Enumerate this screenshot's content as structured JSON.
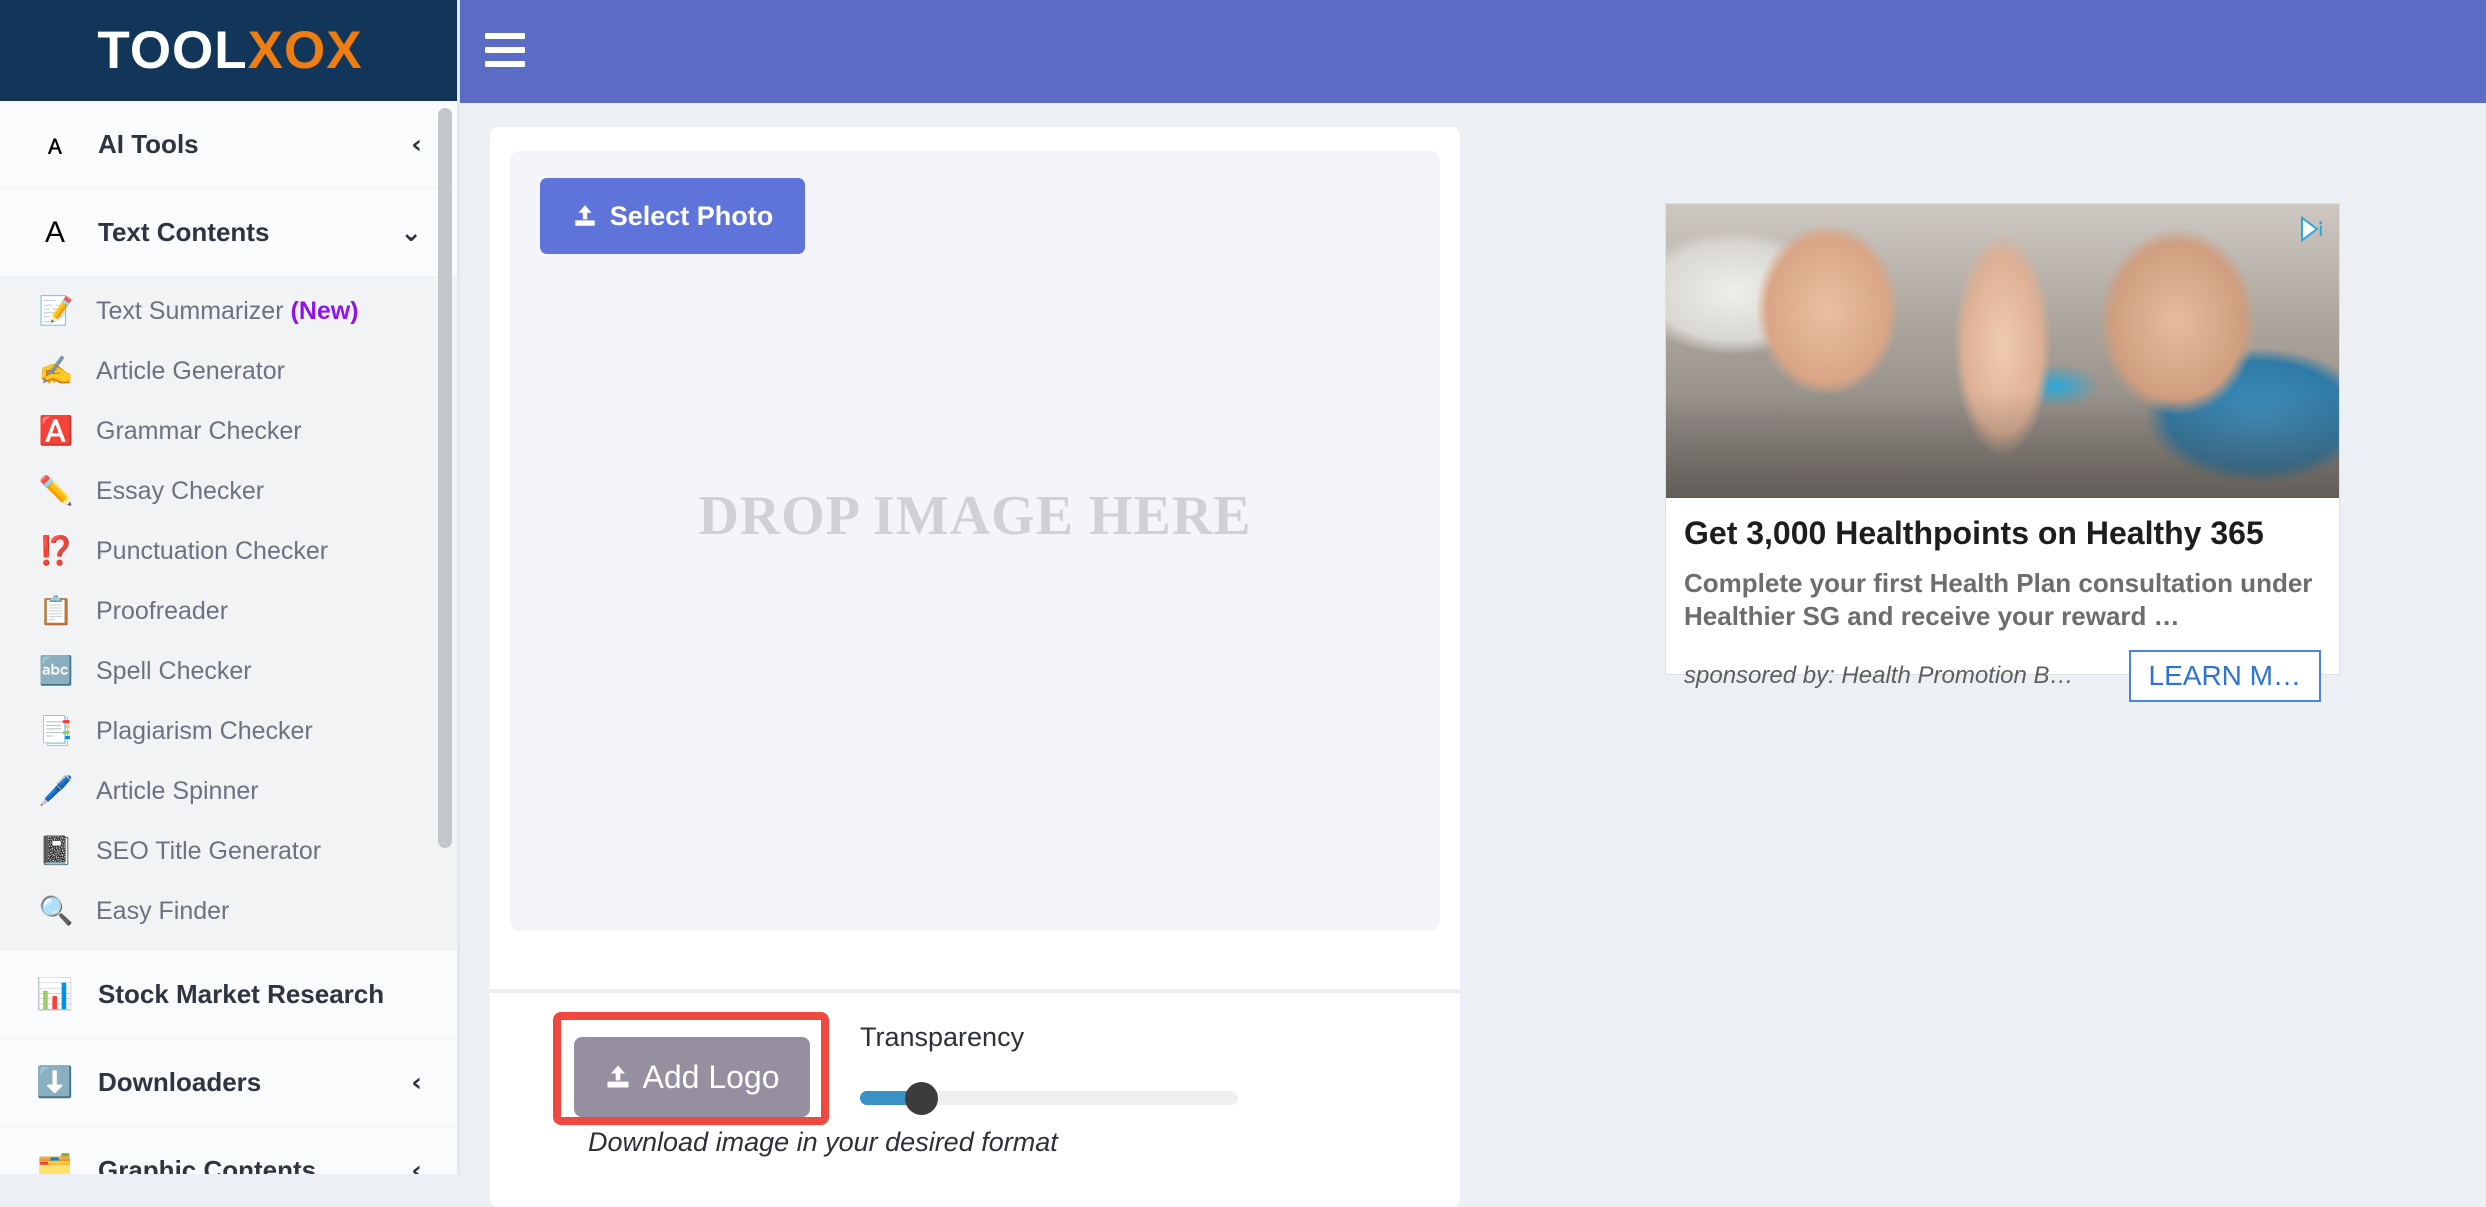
{
  "brand": {
    "word_white": "TOOL",
    "word_orange": "XOX"
  },
  "topbar": {
    "menu_icon": "hamburger-icon"
  },
  "sidebar": {
    "groups": [
      {
        "id": "ai-tools",
        "label": "AI Tools",
        "icon": "ai-tools-icon",
        "icon_glyph": "ᴀ",
        "chevron": "‹",
        "expanded": false,
        "items": []
      },
      {
        "id": "text-contents",
        "label": "Text Contents",
        "icon": "text-contents-icon",
        "icon_glyph": "A",
        "chevron": "⌄",
        "expanded": true,
        "items": [
          {
            "label": "Text Summarizer",
            "badge": "(New)",
            "icon": "text-summarizer-icon",
            "icon_glyph": "📝"
          },
          {
            "label": "Article Generator",
            "badge": "",
            "icon": "article-generator-icon",
            "icon_glyph": "✍️"
          },
          {
            "label": "Grammar Checker",
            "badge": "",
            "icon": "grammar-checker-icon",
            "icon_glyph": "🅰️"
          },
          {
            "label": "Essay Checker",
            "badge": "",
            "icon": "essay-checker-icon",
            "icon_glyph": "✏️"
          },
          {
            "label": "Punctuation Checker",
            "badge": "",
            "icon": "punctuation-checker-icon",
            "icon_glyph": "⁉️"
          },
          {
            "label": "Proofreader",
            "badge": "",
            "icon": "proofreader-icon",
            "icon_glyph": "📋"
          },
          {
            "label": "Spell Checker",
            "badge": "",
            "icon": "spell-checker-icon",
            "icon_glyph": "🔤"
          },
          {
            "label": "Plagiarism Checker",
            "badge": "",
            "icon": "plagiarism-checker-icon",
            "icon_glyph": "📑"
          },
          {
            "label": "Article Spinner",
            "badge": "",
            "icon": "article-spinner-icon",
            "icon_glyph": "🖊️"
          },
          {
            "label": "SEO Title Generator",
            "badge": "",
            "icon": "seo-title-generator-icon",
            "icon_glyph": "📓"
          },
          {
            "label": "Easy Finder",
            "badge": "",
            "icon": "easy-finder-icon",
            "icon_glyph": "🔍"
          }
        ]
      },
      {
        "id": "stock-market-research",
        "label": "Stock Market Research",
        "icon": "stock-market-icon",
        "icon_glyph": "📊",
        "chevron": "",
        "expanded": false,
        "items": []
      },
      {
        "id": "downloaders",
        "label": "Downloaders",
        "icon": "downloaders-icon",
        "icon_glyph": "⬇️",
        "chevron": "‹",
        "expanded": false,
        "items": []
      },
      {
        "id": "graphic-contents",
        "label": "Graphic Contents",
        "icon": "graphic-contents-icon",
        "icon_glyph": "🗂️",
        "chevron": "‹",
        "expanded": false,
        "items": []
      }
    ]
  },
  "tool": {
    "select_photo_label": "Select Photo",
    "dropzone_text": "DROP IMAGE HERE",
    "add_logo_label": "Add Logo",
    "transparency_label": "Transparency",
    "transparency_value": 13,
    "download_note": "Download image in your desired format"
  },
  "ad": {
    "title": "Get 3,000 Healthpoints on Healthy 365",
    "description": "Complete your first Health Plan consultation under Healthier SG and receive your reward …",
    "sponsor": "sponsored by: Health Promotion B…",
    "cta_label": "LEARN M…",
    "badge_icon": "adchoices-icon"
  },
  "colors": {
    "brand_navy": "#12365a",
    "brand_orange": "#f07d12",
    "topbar": "#5a6cc4",
    "primary_button": "#5f74da",
    "muted_button": "#968fa0",
    "highlight": "#f0483e",
    "slider_fill": "#3a92c4",
    "new_badge": "#9013e8"
  }
}
